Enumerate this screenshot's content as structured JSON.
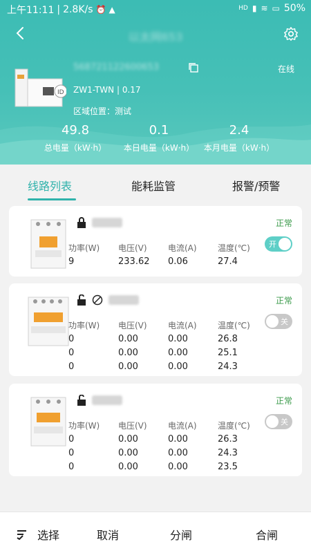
{
  "status_bar": {
    "time": "上午11:11",
    "net_speed": "2.8K/s",
    "network": "HD",
    "battery": "50%"
  },
  "header": {
    "device_name": "以太网653",
    "device_id": "568721122600653",
    "online": "在线",
    "model": "ZW1-TWN",
    "version": "0.17",
    "region_label": "区域位置：",
    "region_value": "测试"
  },
  "stats": [
    {
      "value": "49.8",
      "label": "总电量（kW·h）"
    },
    {
      "value": "0.1",
      "label": "本日电量（kW·h）"
    },
    {
      "value": "2.4",
      "label": "本月电量（kW·h）"
    }
  ],
  "tabs": [
    "线路列表",
    "能耗监管",
    "报警/预警"
  ],
  "metric_headers": [
    "功率(W)",
    "电压(V)",
    "电流(A)",
    "温度(℃)"
  ],
  "cards": [
    {
      "name": "001",
      "status": "正常",
      "toggle": "开",
      "rows": [
        [
          "9",
          "233.62",
          "0.06",
          "27.4"
        ]
      ]
    },
    {
      "name": "002",
      "status": "正常",
      "toggle": "关",
      "rows": [
        [
          "0",
          "0.00",
          "0.00",
          "26.8"
        ],
        [
          "0",
          "0.00",
          "0.00",
          "25.1"
        ],
        [
          "0",
          "0.00",
          "0.00",
          "24.3"
        ]
      ]
    },
    {
      "name": "003",
      "status": "正常",
      "toggle": "关",
      "rows": [
        [
          "0",
          "0.00",
          "0.00",
          "26.3"
        ],
        [
          "0",
          "0.00",
          "0.00",
          "24.3"
        ],
        [
          "0",
          "0.00",
          "0.00",
          "23.5"
        ]
      ]
    }
  ],
  "bottom": {
    "select": "选择",
    "cancel": "取消",
    "open": "分闸",
    "close": "合闸"
  },
  "colors": {
    "accent": "#2fb2ab",
    "header": "#3cbcb4",
    "toggle_on": "#5ecfc7",
    "toggle_off": "#c8c8c8",
    "status_ok": "#3a9a4a"
  }
}
